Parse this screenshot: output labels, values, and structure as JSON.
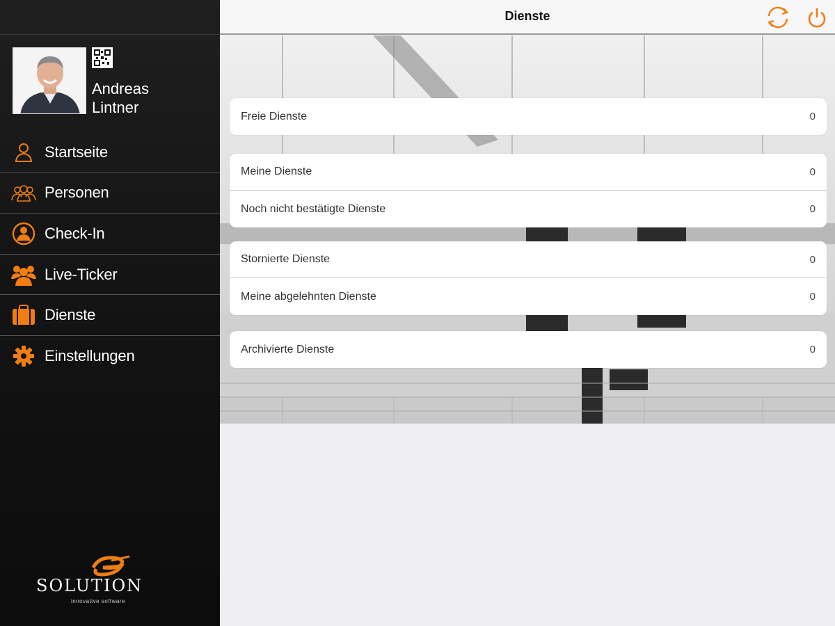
{
  "header": {
    "title": "Dienste"
  },
  "profile": {
    "first_name": "Andreas",
    "last_name": "Lintner"
  },
  "sidebar": {
    "items": [
      {
        "label": "Startseite",
        "icon": "person-outline-icon"
      },
      {
        "label": "Personen",
        "icon": "people-outline-icon"
      },
      {
        "label": "Check-In",
        "icon": "person-circle-icon"
      },
      {
        "label": "Live-Ticker",
        "icon": "group-icon"
      },
      {
        "label": "Dienste",
        "icon": "briefcase-icon"
      },
      {
        "label": "Einstellungen",
        "icon": "gear-icon"
      }
    ]
  },
  "groups": [
    {
      "cells": [
        {
          "label": "Freie Dienste",
          "count": "0"
        }
      ]
    },
    {
      "cells": [
        {
          "label": "Meine Dienste",
          "count": "0"
        },
        {
          "label": "Noch nicht bestätigte Dienste",
          "count": "0"
        }
      ]
    },
    {
      "cells": [
        {
          "label": "Stornierte Dienste",
          "count": "0"
        },
        {
          "label": "Meine abgelehnten Dienste",
          "count": "0"
        }
      ]
    },
    {
      "cells": [
        {
          "label": "Archivierte Dienste",
          "count": "0"
        }
      ]
    }
  ],
  "logo": {
    "name": "SOLUTION",
    "tagline": "innovative software"
  },
  "colors": {
    "accent": "#f07d14",
    "sidebar_bg": "#141414",
    "content_bg": "#efeef3"
  }
}
